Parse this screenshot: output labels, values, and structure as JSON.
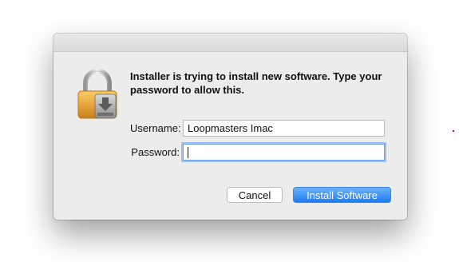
{
  "dialog": {
    "message": "Installer is trying to install new software. Type your password to allow this.",
    "icon": "lock-installer-icon"
  },
  "fields": {
    "username_label": "Username:",
    "username_value": "Loopmasters Imac",
    "password_label": "Password:",
    "password_value": ""
  },
  "buttons": {
    "cancel_label": "Cancel",
    "install_label": "Install Software"
  },
  "colors": {
    "accent": "#1d7bf2",
    "focus_ring": "#9ec0ee",
    "lock_gold": "#e9a53a"
  }
}
